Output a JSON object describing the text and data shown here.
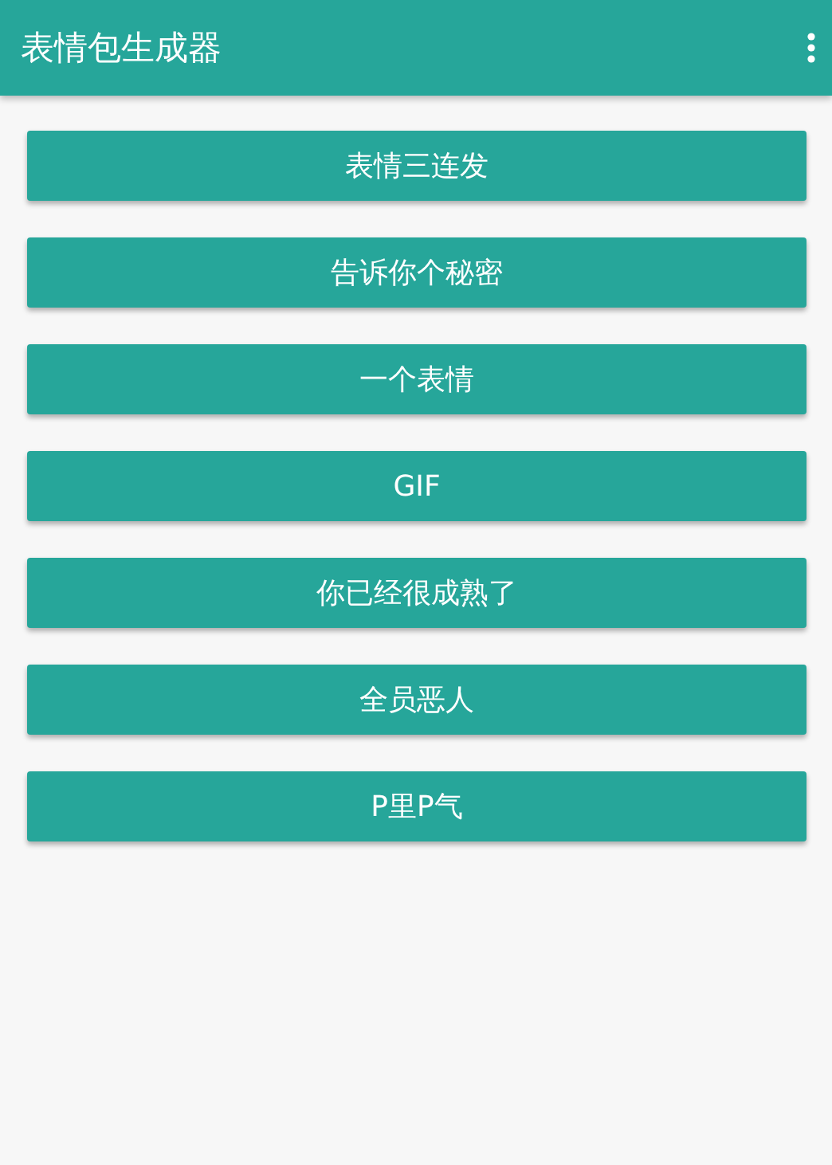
{
  "app_bar": {
    "title": "表情包生成器"
  },
  "buttons": [
    {
      "label": "表情三连发"
    },
    {
      "label": "告诉你个秘密"
    },
    {
      "label": "一个表情"
    },
    {
      "label": "GIF"
    },
    {
      "label": "你已经很成熟了"
    },
    {
      "label": "全员恶人"
    },
    {
      "label": "P里P气"
    }
  ]
}
